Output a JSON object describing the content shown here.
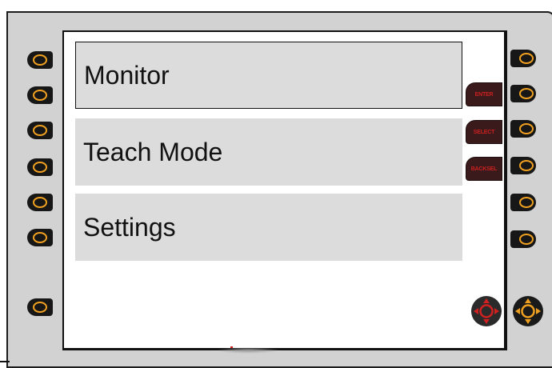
{
  "menu": {
    "items": [
      {
        "label": "Monitor",
        "selected": true
      },
      {
        "label": "Teach Mode",
        "selected": false
      },
      {
        "label": "Settings",
        "selected": false
      }
    ]
  },
  "soft_keys": {
    "enter": "ENTER",
    "select": "SELECT",
    "backsel": "BACKSEL"
  },
  "colors": {
    "bezel": "#d2d2d2",
    "button_ring": "#f0a020",
    "soft_key_text": "#cc2020",
    "menu_item_bg": "#dcdcdc"
  },
  "icons": {
    "dpad_screen": "dpad-red-icon",
    "dpad_bezel": "dpad-orange-icon"
  }
}
